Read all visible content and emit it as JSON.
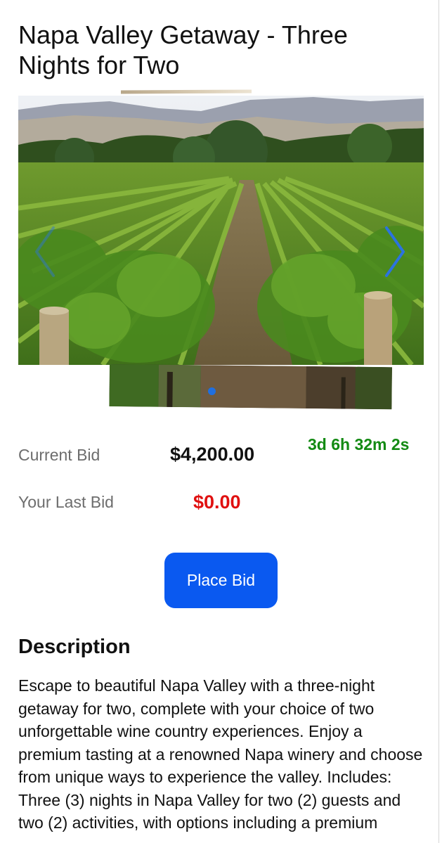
{
  "listing": {
    "title": "Napa Valley Getaway - Three Nights for Two"
  },
  "carousel": {
    "image_description": "vineyard-rows-hills-photo",
    "prev_icon": "chevron-left-icon",
    "next_icon": "chevron-right-icon",
    "active_index": 0,
    "accent_color": "#1f6fe0"
  },
  "bidding": {
    "current_bid_label": "Current Bid",
    "current_bid_value": "$4,200.00",
    "time_remaining": "3d 6h 32m 2s",
    "last_bid_label": "Your Last Bid",
    "last_bid_value": "$0.00",
    "place_bid_label": "Place Bid",
    "timer_color": "#138a13",
    "last_bid_color": "#e01010",
    "button_color": "#0a59f0"
  },
  "description": {
    "heading": "Description",
    "text": "Escape to beautiful Napa Valley with a three-night getaway for two, complete with your choice of two unforgettable wine country experiences. Enjoy a premium tasting at a renowned Napa winery and choose from unique ways to experience the valley. Includes: Three (3) nights in Napa Valley for two (2) guests and two (2) activities, with options including a premium"
  }
}
